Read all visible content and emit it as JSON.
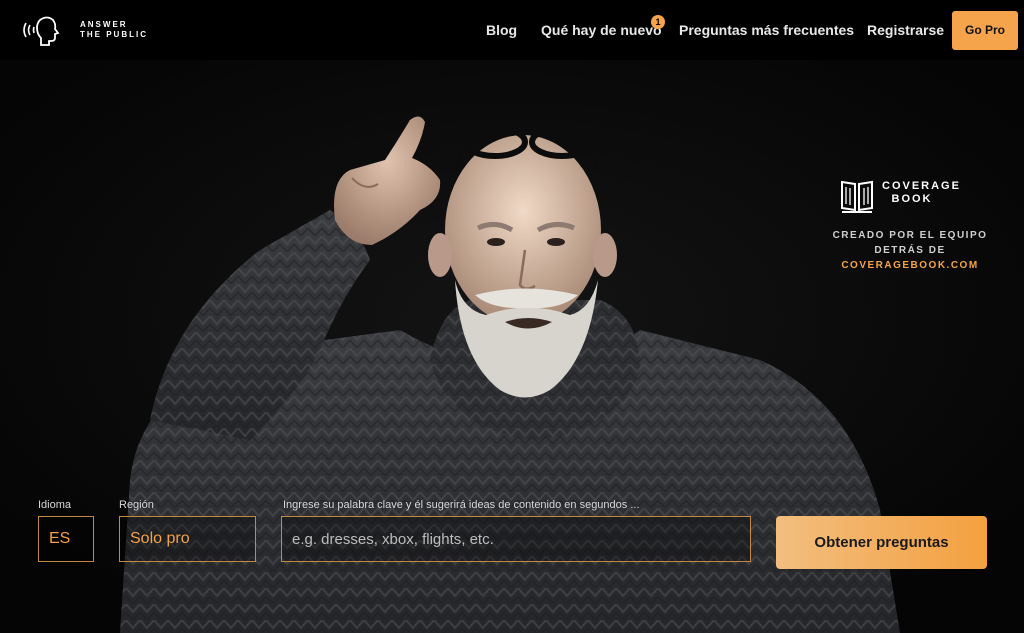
{
  "header": {
    "logo_line1": "ANSWER",
    "logo_line2": "THE PUBLIC",
    "nav": [
      "Blog",
      "Qué hay de nuevo",
      "Preguntas más frecuentes",
      "Registrarse"
    ],
    "new_badge": "1",
    "go_pro": "Go Pro"
  },
  "promo": {
    "brand_line1": "COVERAGE",
    "brand_line2": "BOOK",
    "by_line1": "CREADO POR EL EQUIPO",
    "by_line2": "DETRÁS DE",
    "link": "COVERAGEBOOK.COM"
  },
  "search": {
    "language_label": "Idioma",
    "language_value": "ES",
    "region_label": "Región",
    "region_value": "Solo pro",
    "keyword_label": "Ingrese su palabra clave y él sugerirá ideas de contenido en segundos ...",
    "keyword_placeholder": "e.g. dresses, xbox, flights, etc.",
    "keyword_value": "",
    "submit": "Obtener preguntas"
  },
  "colors": {
    "accent": "#f5a44b",
    "field_border": "#c48a42",
    "background": "#060606"
  },
  "icons": [
    "speaking-head-logo-icon",
    "book-icon"
  ]
}
